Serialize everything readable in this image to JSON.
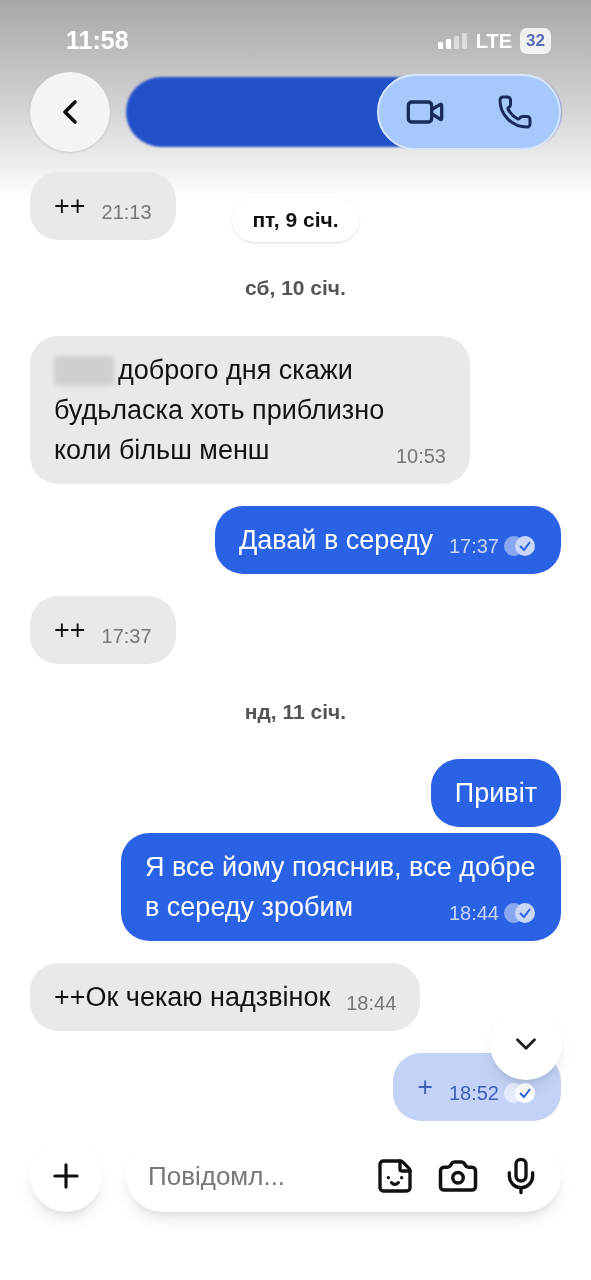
{
  "status_bar": {
    "time": "11:58",
    "network": "LTE",
    "battery": "32"
  },
  "sticky_date": "пт, 9 січ.",
  "messages": [
    {
      "kind": "incoming",
      "text": "++",
      "time": "21:13",
      "redacted": false,
      "faded": false
    },
    {
      "kind": "date",
      "text": "сб, 10 січ."
    },
    {
      "kind": "incoming",
      "text": "доброго дня скажи будьласка хоть приблизно коли більш менш",
      "time": "10:53",
      "redacted": true,
      "faded": false
    },
    {
      "kind": "outgoing",
      "text": "Давай в середу",
      "time": "17:37",
      "read": true,
      "faded": false
    },
    {
      "kind": "incoming",
      "text": "++",
      "time": "17:37",
      "redacted": false,
      "faded": false
    },
    {
      "kind": "date",
      "text": "нд, 11 січ."
    },
    {
      "kind": "outgoing",
      "text": "Привіт",
      "faded": false
    },
    {
      "kind": "outgoing",
      "text": "Я все йому пояснив, все добре в середу зробим",
      "time": "18:44",
      "read": true,
      "faded": false
    },
    {
      "kind": "incoming",
      "text": "++Ок чекаю надзвінок",
      "time": "18:44",
      "redacted": false,
      "faded": false
    },
    {
      "kind": "outgoing",
      "text": "+",
      "time": "18:52",
      "read": true,
      "faded": true
    }
  ],
  "composer": {
    "placeholder": "Повідомл..."
  }
}
